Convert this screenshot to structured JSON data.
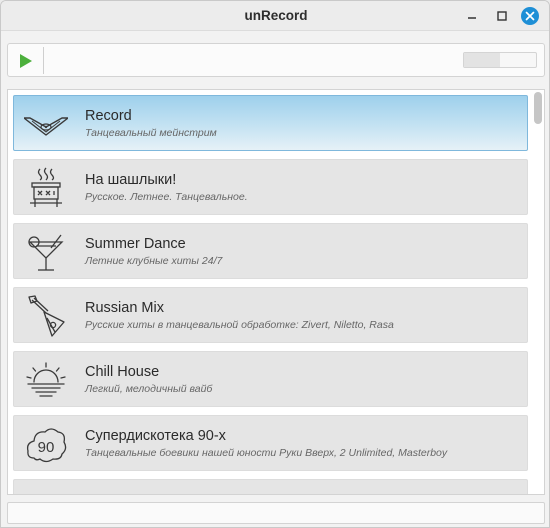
{
  "window": {
    "title": "unRecord",
    "controls": {
      "minimize": "minimize",
      "maximize": "maximize",
      "close": "close"
    },
    "accent": "#1e8fd6"
  },
  "toolbar": {
    "play_icon": "play-icon",
    "play_color": "#4caf3c",
    "volume_level": 0.5
  },
  "stations": [
    {
      "name": "Record",
      "description": "Танцевальный мейнстрим",
      "icon": "record-wings-logo-icon",
      "selected": true
    },
    {
      "name": "На шашлыки!",
      "description": "Русское. Летнее. Танцевальное.",
      "icon": "grill-icon",
      "selected": false
    },
    {
      "name": "Summer Dance",
      "description": "Летние клубные хиты 24/7",
      "icon": "cocktail-glass-icon",
      "selected": false
    },
    {
      "name": "Russian Mix",
      "description": "Русские хиты в танцевальной обработке: Zivert, Niletto, Rasa",
      "icon": "balalaika-icon",
      "selected": false
    },
    {
      "name": "Chill House",
      "description": "Легкий, мелодичный вайб",
      "icon": "sunset-icon",
      "selected": false
    },
    {
      "name": "Супердискотека 90-х",
      "description": "Танцевальные боевики нашей юности Руки Вверх, 2 Unlimited, Masterboy",
      "icon": "cloud-90-icon",
      "badge": "90",
      "selected": false
    },
    {
      "name": "",
      "description": "",
      "icon": "partial-station-icon",
      "selected": false
    }
  ],
  "statusbar": {
    "text": ""
  }
}
